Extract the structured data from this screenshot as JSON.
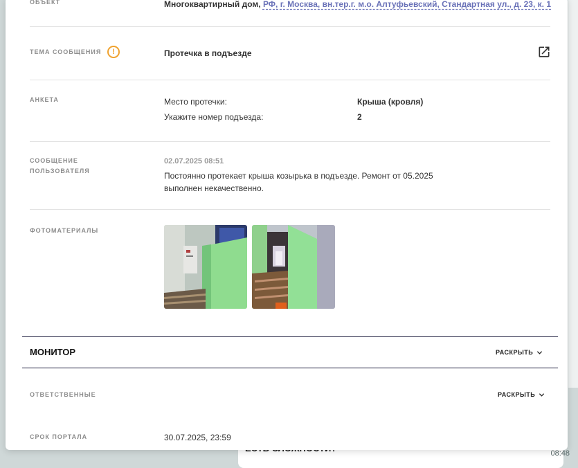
{
  "object": {
    "label": "Объект",
    "type_text": "Многоквартирный дом,",
    "address": "РФ, г. Москва, вн.тер.г. м.о. Алтуфьевский, Стандартная ул., д. 23, к. 1"
  },
  "topic": {
    "label": "Тема сообщения",
    "warn_glyph": "!",
    "value": "Протечка в подъезде",
    "icon": "open-in-new-icon"
  },
  "survey": {
    "label": "Анкета",
    "items": [
      {
        "question": "Место протечки:",
        "answer": "Крыша (кровля)"
      },
      {
        "question": "Укажите номер подъезда:",
        "answer": "2"
      }
    ]
  },
  "user_message": {
    "label_line1": "Сообщение",
    "label_line2": "пользователя",
    "timestamp": "02.07.2025 08:51",
    "text_line1": "Постоянно протекает крыша козырька в подъезде. Ремонт от 05.2025",
    "text_line2": "выполнен некачественно."
  },
  "photos": {
    "label": "Фотоматериалы",
    "items": [
      {
        "name": "photo-stairwell-1"
      },
      {
        "name": "photo-stairwell-2"
      }
    ]
  },
  "monitor": {
    "title": "МОНИТОР",
    "expand_label": "РАСКРЫТЬ"
  },
  "responsible": {
    "label": "Ответственные",
    "expand_label": "РАСКРЫТЬ"
  },
  "deadline": {
    "label": "Срок портала",
    "value": "30.07.2025, 23:59"
  },
  "background": {
    "bubble_text": "ЕСТЬ СЛОЖНОСТИ?",
    "time": "08:48"
  },
  "colors": {
    "accent_link": "#6a72b8",
    "warning": "#f0a22e",
    "section_border": "#1c1c3c"
  }
}
